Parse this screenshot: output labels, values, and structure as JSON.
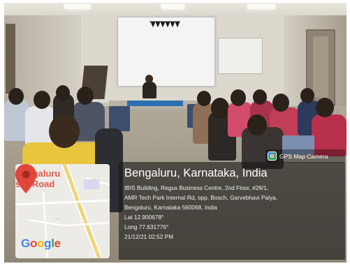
{
  "gps_badge": {
    "icon": "gps-map-camera-icon",
    "label": "GPS Map Camera"
  },
  "map": {
    "label_line1": "Bengaluru",
    "label_line2": "sur Road",
    "dots": "...",
    "google_logo": [
      "G",
      "o",
      "o",
      "g",
      "l",
      "e"
    ],
    "google_colors": [
      "#4285f4",
      "#ea4335",
      "#fbbc05",
      "#4285f4",
      "#34a853",
      "#ea4335"
    ],
    "pin_color": "#e0463b"
  },
  "location": {
    "title": "Bengaluru, Karnataka, India",
    "address_line1": "IBIS Building, Regus Business Centre, 2nd Floor, #26/1,",
    "address_line2": "AMR Tech Park Internal Rd, opp. Bosch, Garvebhavi Palya,",
    "address_line3": "Bengaluru, Karnataka 560068, India",
    "lat": "Lat 12.900678°",
    "long": "Long 77.631776°",
    "datetime": "21/12/21 02:52 PM"
  }
}
